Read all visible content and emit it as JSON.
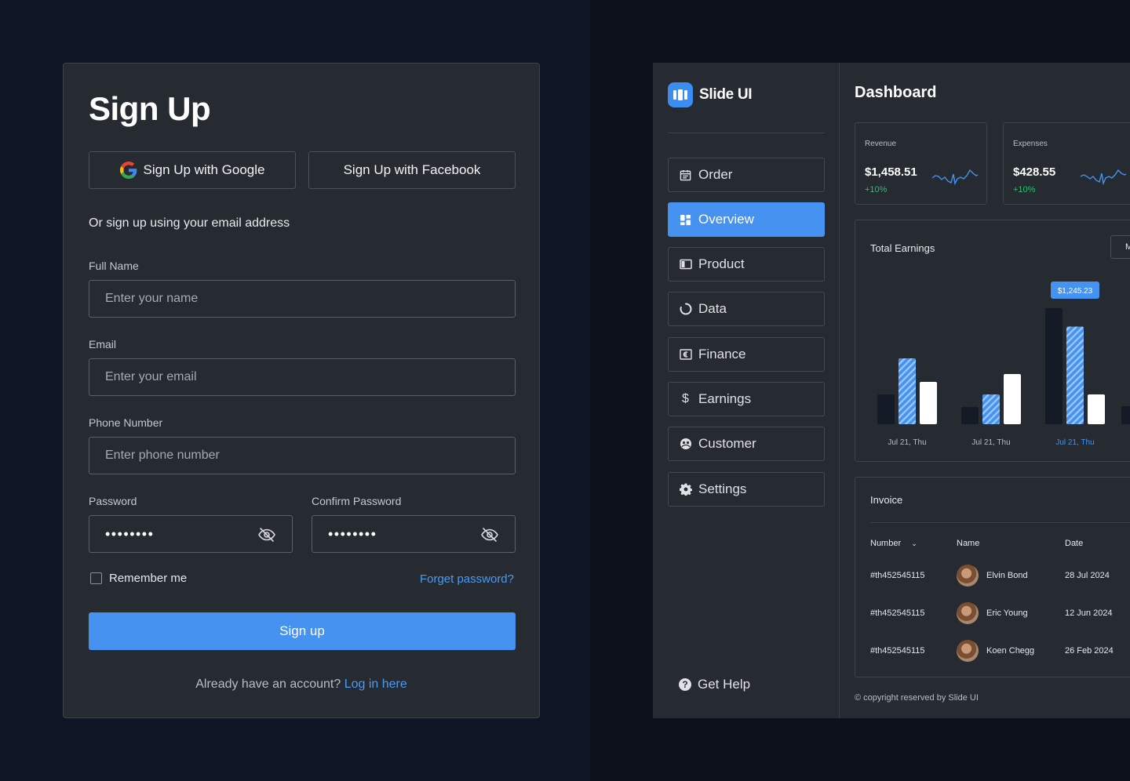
{
  "signup": {
    "title": "Sign Up",
    "google_label": "Sign Up with Google",
    "facebook_label": "Sign Up with Facebook",
    "or_text": "Or sign up using your email address",
    "fullname_label": "Full Name",
    "fullname_placeholder": "Enter your name",
    "email_label": "Email",
    "email_placeholder": "Enter your email",
    "phone_label": "Phone Number",
    "phone_placeholder": "Enter phone number",
    "password_label": "Password",
    "password_value": "••••••••",
    "confirm_label": "Confirm Password",
    "confirm_value": "••••••••",
    "remember_label": "Remember me",
    "forgot_label": "Forget password?",
    "submit_label": "Sign up",
    "already_text": "Already have an account?",
    "login_link": "Log in here"
  },
  "dashboard": {
    "brand": "Slide UI",
    "title": "Dashboard",
    "nav": [
      {
        "label": "Order",
        "icon": "calendar-icon"
      },
      {
        "label": "Overview",
        "icon": "grid-icon",
        "active": true
      },
      {
        "label": "Product",
        "icon": "product-icon"
      },
      {
        "label": "Data",
        "icon": "loading-circle-icon"
      },
      {
        "label": "Finance",
        "icon": "euro-icon"
      },
      {
        "label": "Earnings",
        "icon": "dollar-icon"
      },
      {
        "label": "Customer",
        "icon": "customer-icon"
      },
      {
        "label": "Settings",
        "icon": "gear-icon"
      }
    ],
    "help_label": "Get Help",
    "stats": [
      {
        "label": "Revenue",
        "value": "$1,458.51",
        "change": "+10%"
      },
      {
        "label": "Expenses",
        "value": "$428.55",
        "change": "+10%"
      }
    ],
    "earnings_title": "Total Earnings",
    "period_button": "M",
    "invoice": {
      "title": "Invoice",
      "headers": {
        "number": "Number",
        "name": "Name",
        "date": "Date"
      },
      "rows": [
        {
          "number": "#th452545115",
          "name": "Elvin Bond",
          "date": "28 Jul 2024"
        },
        {
          "number": "#th452545115",
          "name": "Eric Young",
          "date": "12 Jun 2024"
        },
        {
          "number": "#th452545115",
          "name": "Koen Chegg",
          "date": "26 Feb 2024"
        }
      ]
    },
    "copyright": "© copyright reserved by Slide UI"
  },
  "colors": {
    "accent": "#4592f1",
    "positive": "#2bbf74",
    "bar_dark": "#141a26",
    "bar_white": "#ffffff"
  },
  "chart_data": {
    "type": "bar",
    "title": "Total Earnings",
    "categories": [
      "Jul 21, Thu",
      "Jul 21, Thu",
      "Jul 21, Thu"
    ],
    "highlighted_category": 2,
    "tooltip": "$1,245.23",
    "series": [
      {
        "values": [
          380,
          220,
          1480
        ]
      },
      {
        "values": [
          840,
          380,
          1245
        ]
      },
      {
        "values": [
          540,
          640,
          380
        ]
      }
    ],
    "ylim": [
      0,
      1600
    ]
  }
}
